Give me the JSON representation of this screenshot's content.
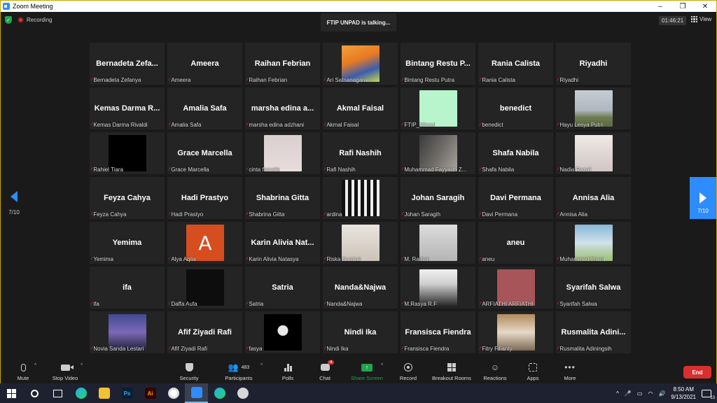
{
  "window": {
    "title": "Zoom Meeting",
    "minimize": "–",
    "maximize": "❐",
    "close": "✕"
  },
  "topbar": {
    "recording_label": "Recording",
    "talking": "FTIP UNPAD is talking...",
    "timer": "01:46:21",
    "view_label": "View"
  },
  "pager": {
    "left_label": "7/10",
    "right_label": "7/10"
  },
  "tiles": [
    {
      "name": "Bernadeta  Zefa...",
      "label": "Bernadeta Zefanya",
      "video": ""
    },
    {
      "name": "Ameera",
      "label": "Ameera",
      "video": ""
    },
    {
      "name": "Raihan Febrian",
      "label": "Raihan Febrian",
      "video": ""
    },
    {
      "name": "",
      "label": "Ari Satrianagara",
      "video": "v-baby"
    },
    {
      "name": "Bintang  Restu  P...",
      "label": "Bintang Restu Putra",
      "video": ""
    },
    {
      "name": "Rania Calista",
      "label": "Rania Calista",
      "video": ""
    },
    {
      "name": "Riyadhi",
      "label": "Riyadhi",
      "video": ""
    },
    {
      "name": "Kemas  Darma  R...",
      "label": "Kemas Darma Rivaldi",
      "video": ""
    },
    {
      "name": "Amalia Safa",
      "label": "Amalia Safa",
      "video": ""
    },
    {
      "name": "marsha  edina  a...",
      "label": "marsha edina adzhani",
      "video": ""
    },
    {
      "name": "Akmal Faisal",
      "label": "Akmal Faisal",
      "video": ""
    },
    {
      "name": "",
      "label": "FTIP_Misael",
      "video": "v-mint"
    },
    {
      "name": "benedict",
      "label": "benedict",
      "video": ""
    },
    {
      "name": "",
      "label": "Hayu Lesya Putri",
      "video": "v-sky"
    },
    {
      "name": "",
      "label": "Rahiel Tiara",
      "video": "v-black"
    },
    {
      "name": "Grace Marcella",
      "label": "Grace Marcella",
      "video": ""
    },
    {
      "name": "",
      "label": "cinta famella",
      "video": "v-twins"
    },
    {
      "name": "Rafi Nashih",
      "label": "Rafi Nashih",
      "video": ""
    },
    {
      "name": "",
      "label": "Muhammad Fayyadh Z...",
      "video": "v-room"
    },
    {
      "name": "Shafa Nabila",
      "label": "Shafa Nabila",
      "video": ""
    },
    {
      "name": "",
      "label": "Nadia Razali",
      "video": "v-woman"
    },
    {
      "name": "Feyza Cahya",
      "label": "Feyza Cahya",
      "video": ""
    },
    {
      "name": "Hadi Prastyo",
      "label": "Hadi Prastyo",
      "video": ""
    },
    {
      "name": "Shabrina Gitta",
      "label": "Shabrina Gitta",
      "video": ""
    },
    {
      "name": "",
      "label": "ardina",
      "video": "v-stripes"
    },
    {
      "name": "Johan Saragih",
      "label": "Johan Saragih",
      "video": ""
    },
    {
      "name": "Davi Permana",
      "label": "Davi Permana",
      "video": ""
    },
    {
      "name": "Annisa Alia",
      "label": "Annisa Alia",
      "video": ""
    },
    {
      "name": "Yemima",
      "label": "Yemima",
      "video": ""
    },
    {
      "name": "",
      "label": "Alya Aqila",
      "video": "v-orange",
      "letter": "A"
    },
    {
      "name": "Karin  Alivia  Nat...",
      "label": "Karin Alivia Natasya",
      "video": ""
    },
    {
      "name": "",
      "label": "Riska Sumirat",
      "video": "v-hijab"
    },
    {
      "name": "",
      "label": "M. Raihan",
      "video": "v-grey"
    },
    {
      "name": "aneu",
      "label": "aneu",
      "video": ""
    },
    {
      "name": "",
      "label": "Muhammad Ilham",
      "video": "v-family"
    },
    {
      "name": "ifa",
      "label": "ifa",
      "video": ""
    },
    {
      "name": "",
      "label": "Daffa Aufa",
      "video": "v-dark"
    },
    {
      "name": "Satria",
      "label": "Satria",
      "video": ""
    },
    {
      "name": "Nanda&Najwa",
      "label": "Nanda&Najwa",
      "video": ""
    },
    {
      "name": "",
      "label": "M.Rasya R.F",
      "video": "v-back"
    },
    {
      "name": "",
      "label": "ARFIATHI ARFIATHI",
      "video": "v-rose"
    },
    {
      "name": "Syarifah Salwa",
      "label": "Syarifah Salwa",
      "video": ""
    },
    {
      "name": "",
      "label": "Novia Sanda Lestari",
      "video": "v-concert"
    },
    {
      "name": "Afif Ziyadi Rafi",
      "label": "Afif Ziyadi Rafi",
      "video": ""
    },
    {
      "name": "",
      "label": "fasya",
      "video": "v-space"
    },
    {
      "name": "Nindi Ika",
      "label": "Nindi Ika",
      "video": ""
    },
    {
      "name": "Fransisca Fiendra",
      "label": "Fransisca Fiendra",
      "video": ""
    },
    {
      "name": "",
      "label": "Fitry Filianty",
      "video": "v-class"
    },
    {
      "name": "Rusmalita  Adini...",
      "label": "Rusmalita Adiningsih",
      "video": ""
    }
  ],
  "toolbar": {
    "mute": "Mute",
    "stop_video": "Stop Video",
    "security": "Security",
    "participants": "Participants",
    "participants_count": "483",
    "polls": "Polls",
    "chat": "Chat",
    "chat_badge": "4",
    "share_screen": "Share Screen",
    "record": "Record",
    "breakout_rooms": "Breakout Rooms",
    "reactions": "Reactions",
    "apps": "Apps",
    "more": "More",
    "end": "End"
  },
  "taskbar": {
    "time": "8:50 AM",
    "date": "9/13/2021",
    "notif_count": "13",
    "ps": "Ps",
    "ai": "Ai"
  },
  "colors": {
    "accent": "#2d8cff",
    "share": "#23a24d",
    "end": "#d92f2f",
    "border": "#c8a800"
  },
  "icons": [
    "shield-check-icon",
    "recording-icon",
    "grid-view-icon",
    "chevron-left-icon",
    "chevron-right-icon",
    "mic-muted-icon",
    "mic-icon",
    "video-icon",
    "security-icon",
    "participants-icon",
    "polls-icon",
    "chat-icon",
    "share-screen-icon",
    "record-icon",
    "breakout-rooms-icon",
    "reactions-icon",
    "apps-icon",
    "more-icon",
    "windows-start-icon",
    "search-icon",
    "task-view-icon"
  ]
}
